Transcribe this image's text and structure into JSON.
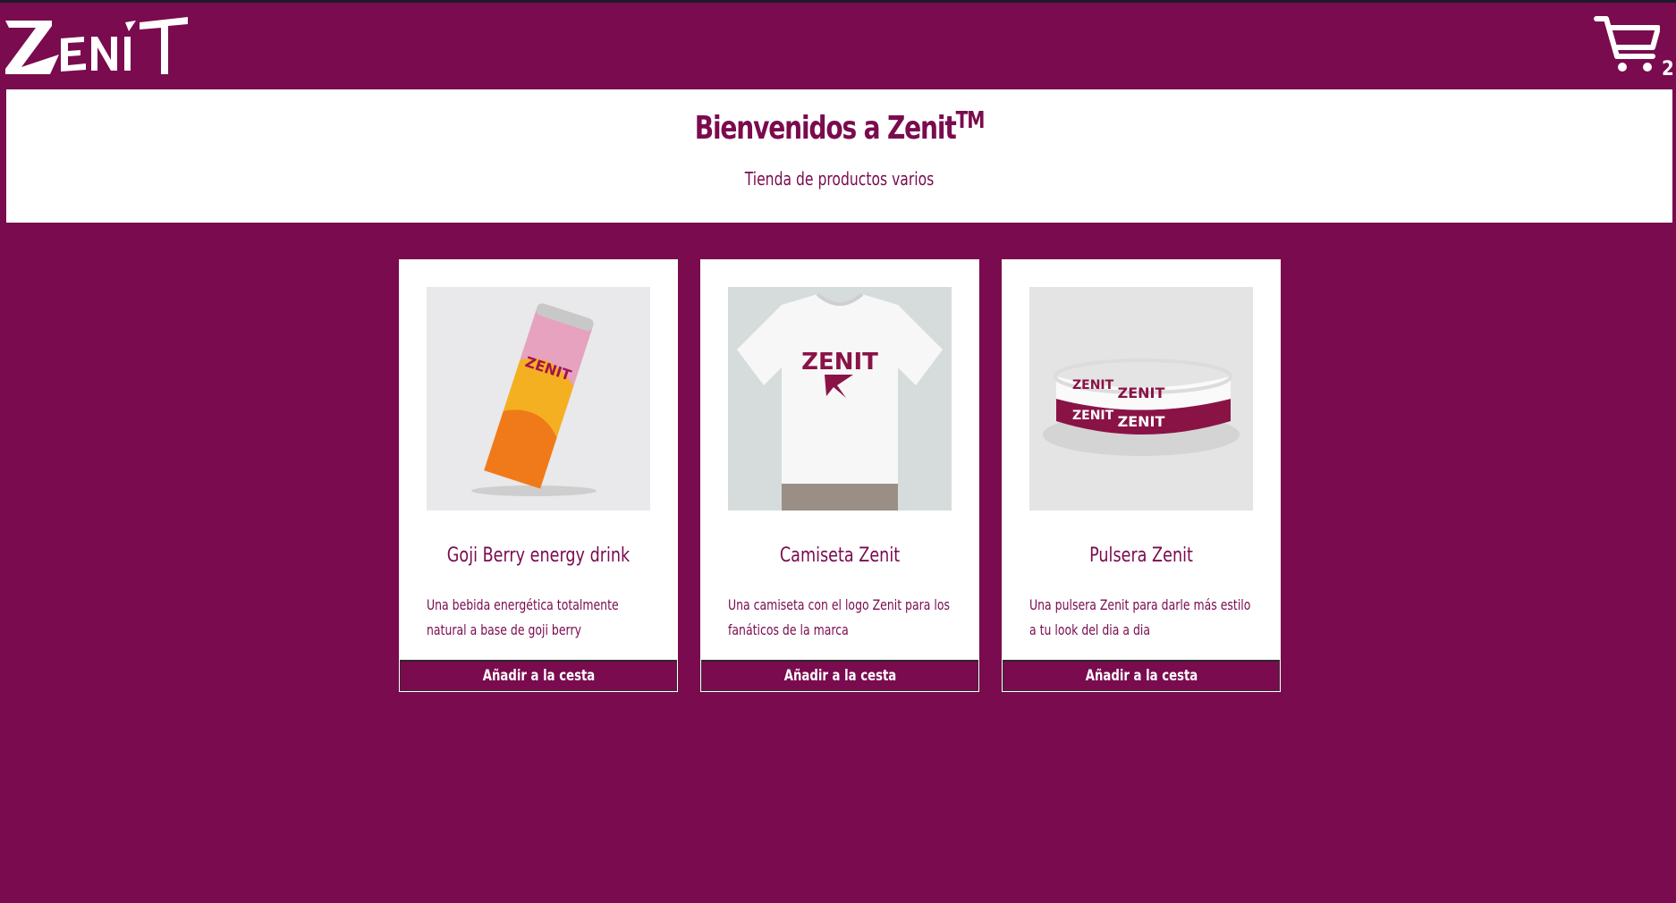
{
  "header": {
    "logo_text": "ZENIT",
    "cart_count": "2",
    "cart_icon": "cart-icon"
  },
  "hero": {
    "title": "Bienvenidos a Zenit",
    "trademark": "TM",
    "subtitle": "Tienda de productos varios"
  },
  "products": [
    {
      "title": "Goji Berry energy drink",
      "description": "Una bebida energética totalmente natural a base de goji berry",
      "button_label": "Añadir a la cesta",
      "image_icon": "energy-drink-can-image"
    },
    {
      "title": "Camiseta Zenit",
      "description": "Una camiseta con el logo Zenit para los fanáticos de la marca",
      "button_label": "Añadir a la cesta",
      "image_icon": "tshirt-image"
    },
    {
      "title": "Pulsera Zenit",
      "description": "Una pulsera Zenit para darle más estilo a tu look del dia a dia",
      "button_label": "Añadir a la cesta",
      "image_icon": "wristband-image"
    }
  ],
  "colors": {
    "brand": "#7a0b4e",
    "surface": "#ffffff"
  }
}
